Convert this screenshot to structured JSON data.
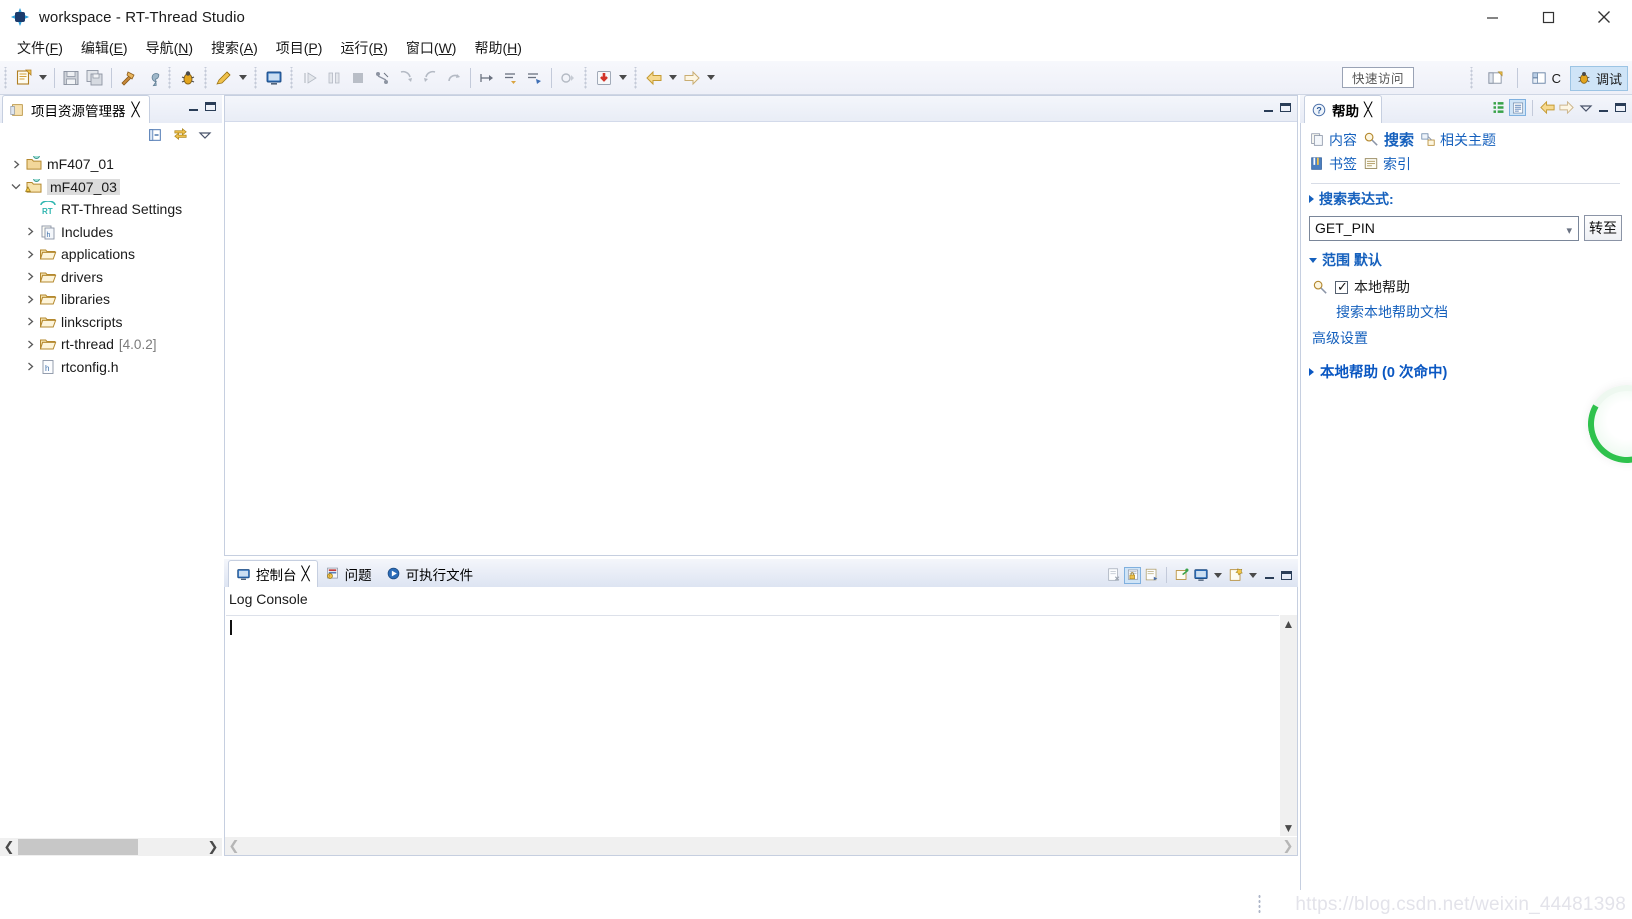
{
  "window": {
    "title": "workspace - RT-Thread Studio",
    "app_icon": "rt-thread-logo-icon",
    "controls": {
      "minimize": "minimize-icon",
      "maximize": "maximize-icon",
      "close": "close-icon"
    }
  },
  "menubar": {
    "items": [
      {
        "label": "文件",
        "mnemonic": "F"
      },
      {
        "label": "编辑",
        "mnemonic": "E"
      },
      {
        "label": "导航",
        "mnemonic": "N"
      },
      {
        "label": "搜索",
        "mnemonic": "A"
      },
      {
        "label": "项目",
        "mnemonic": "P"
      },
      {
        "label": "运行",
        "mnemonic": "R"
      },
      {
        "label": "窗口",
        "mnemonic": "W"
      },
      {
        "label": "帮助",
        "mnemonic": "H"
      }
    ]
  },
  "toolbar": {
    "groups": [
      [
        "new-file-icon",
        "dropdown-arrow"
      ],
      [
        "save-icon",
        "save-all-icon"
      ],
      [
        "build-hammer-icon",
        "build-settings-wrench-icon"
      ],
      [
        "debug-bug-icon"
      ],
      [
        "run-external-tools-icon",
        "dropdown-arrow"
      ],
      [
        "open-console-icon"
      ],
      [
        "resume-icon",
        "suspend-icon",
        "terminate-icon",
        "disconnect-icon",
        "step-into-icon",
        "step-over-icon",
        "step-return-icon"
      ],
      [
        "next-annotation-icon",
        "previous-annotation-icon",
        "last-edit-location-icon"
      ],
      [
        "skip-breakpoints-icon"
      ],
      [
        "download-flash-icon",
        "dropdown-arrow"
      ],
      [
        "back-arrow-icon",
        "dropdown-arrow",
        "forward-arrow-icon",
        "dropdown-arrow"
      ]
    ],
    "quick_access": "快速访问",
    "perspectives": [
      {
        "name": "open-perspective-icon",
        "label": ""
      },
      {
        "name": "c-cpp-perspective",
        "label": "C"
      },
      {
        "name": "debug-perspective",
        "label": "调试",
        "active": true
      }
    ]
  },
  "explorer": {
    "tab_label": "项目资源管理器",
    "tab_icon": "project-explorer-icon",
    "tab_close": "✕",
    "toolbar": [
      "collapse-all-icon",
      "link-with-editor-icon",
      "view-menu-icon"
    ],
    "tree": [
      {
        "label": "mF407_01",
        "icon": "project-closed-icon",
        "indent": 0,
        "expanded": false,
        "arrow": "right",
        "selected": false
      },
      {
        "label": "mF407_03",
        "icon": "project-open-warning-icon",
        "indent": 0,
        "expanded": true,
        "arrow": "down",
        "selected": true
      },
      {
        "label": "RT-Thread Settings",
        "icon": "rt-thread-settings-icon",
        "indent": 1,
        "arrow": "none",
        "selected": false
      },
      {
        "label": "Includes",
        "icon": "includes-icon",
        "indent": 1,
        "arrow": "right",
        "selected": false
      },
      {
        "label": "applications",
        "icon": "folder-icon",
        "indent": 1,
        "arrow": "right",
        "selected": false
      },
      {
        "label": "drivers",
        "icon": "folder-icon",
        "indent": 1,
        "arrow": "right",
        "selected": false
      },
      {
        "label": "libraries",
        "icon": "folder-icon",
        "indent": 1,
        "arrow": "right",
        "selected": false
      },
      {
        "label": "linkscripts",
        "icon": "folder-icon",
        "indent": 1,
        "arrow": "right",
        "selected": false
      },
      {
        "label": "rt-thread",
        "version": "[4.0.2]",
        "icon": "folder-icon",
        "indent": 1,
        "arrow": "right",
        "selected": false
      },
      {
        "label": "rtconfig.h",
        "icon": "header-file-icon",
        "indent": 1,
        "arrow": "right",
        "selected": false
      }
    ]
  },
  "editor": {
    "minimize": "minimize-icon",
    "maximize": "maximize-icon"
  },
  "console": {
    "tabs": [
      {
        "label": "控制台",
        "icon": "console-icon",
        "active": true,
        "closable": true
      },
      {
        "label": "问题",
        "icon": "problems-icon",
        "active": false,
        "closable": false
      },
      {
        "label": "可执行文件",
        "icon": "executables-icon",
        "active": false,
        "closable": false
      }
    ],
    "toolbar": [
      "clear-console-icon",
      "scroll-lock-icon",
      "word-wrap-icon",
      "pin-console-icon",
      "display-selected-console-icon",
      "dropdown-arrow",
      "open-console-icon",
      "dropdown-arrow"
    ],
    "minimize": "minimize-icon",
    "maximize": "maximize-icon",
    "title": "Log Console",
    "content": ""
  },
  "help": {
    "tab_label": "帮助",
    "tab_icon": "help-icon",
    "tab_close": "✕",
    "toolbar": [
      "show-all-topics-icon",
      "show-result-categories-icon",
      "back-arrow-icon",
      "forward-arrow-icon",
      "view-menu-icon",
      "minimize-icon",
      "maximize-icon"
    ],
    "links_row1": [
      {
        "label": "内容",
        "icon": "contents-icon",
        "selected": false
      },
      {
        "label": "搜索",
        "icon": "search-scope-icon",
        "selected": true
      },
      {
        "label": "相关主题",
        "icon": "related-topics-icon",
        "selected": false
      }
    ],
    "links_row2": [
      {
        "label": "书签",
        "icon": "bookmarks-icon",
        "selected": false
      },
      {
        "label": "索引",
        "icon": "index-icon",
        "selected": false
      }
    ],
    "search_expression_label": "搜索表达式:",
    "search_value": "GET_PIN",
    "go_button": "转至",
    "scope_label": "范围 默认",
    "local_help_checkbox": {
      "label": "本地帮助",
      "checked": true,
      "icon": "local-help-icon"
    },
    "local_help_sub": "搜索本地帮助文档",
    "advanced_settings": "高级设置",
    "results_label": "本地帮助 (0 次命中)"
  },
  "statusbar": {
    "watermark": "https://blog.csdn.net/weixin_44481398"
  },
  "colors": {
    "accent_blue": "#1560bd",
    "selection": "#cfe4f7",
    "panel_bg": "#eef0f8",
    "green_badge": "#2fc24d"
  }
}
